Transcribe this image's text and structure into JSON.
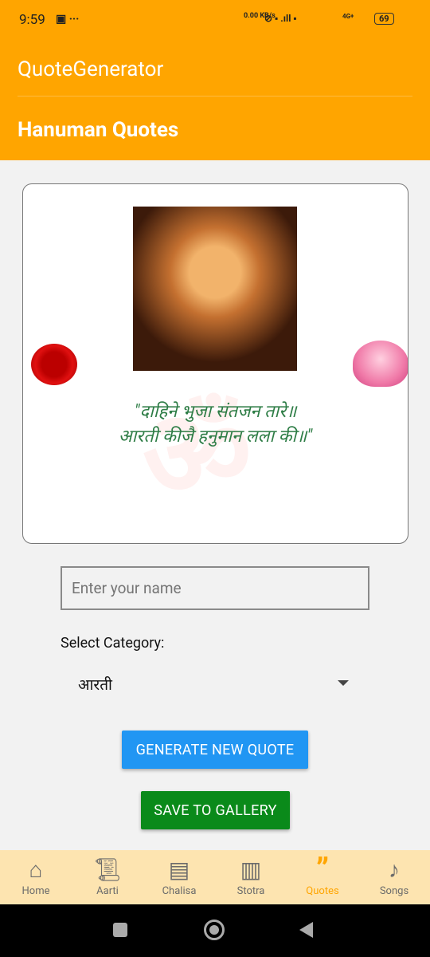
{
  "status": {
    "time": "9:59",
    "net_speed": "0.00 KB/s",
    "battery": "69",
    "network": "4G+"
  },
  "app": {
    "title": "QuoteGenerator",
    "subtitle": "Hanuman Quotes",
    "accent": "#ffa500"
  },
  "card": {
    "quote_line1": "\"दाहिने भुजा संतजन तारे॥",
    "quote_line2": "आरती कीजै हनुमान लला की॥\""
  },
  "form": {
    "name_placeholder": "Enter your name",
    "category_label": "Select Category:",
    "category_value": "आरती"
  },
  "buttons": {
    "generate": "GENERATE NEW QUOTE",
    "save": "SAVE TO GALLERY"
  },
  "nav": [
    {
      "label": "Home",
      "icon": "home-icon"
    },
    {
      "label": "Aarti",
      "icon": "scroll-icon"
    },
    {
      "label": "Chalisa",
      "icon": "book-open-icon"
    },
    {
      "label": "Stotra",
      "icon": "book-icon"
    },
    {
      "label": "Quotes",
      "icon": "quote-icon",
      "active": true
    },
    {
      "label": "Songs",
      "icon": "music-note-icon"
    }
  ]
}
